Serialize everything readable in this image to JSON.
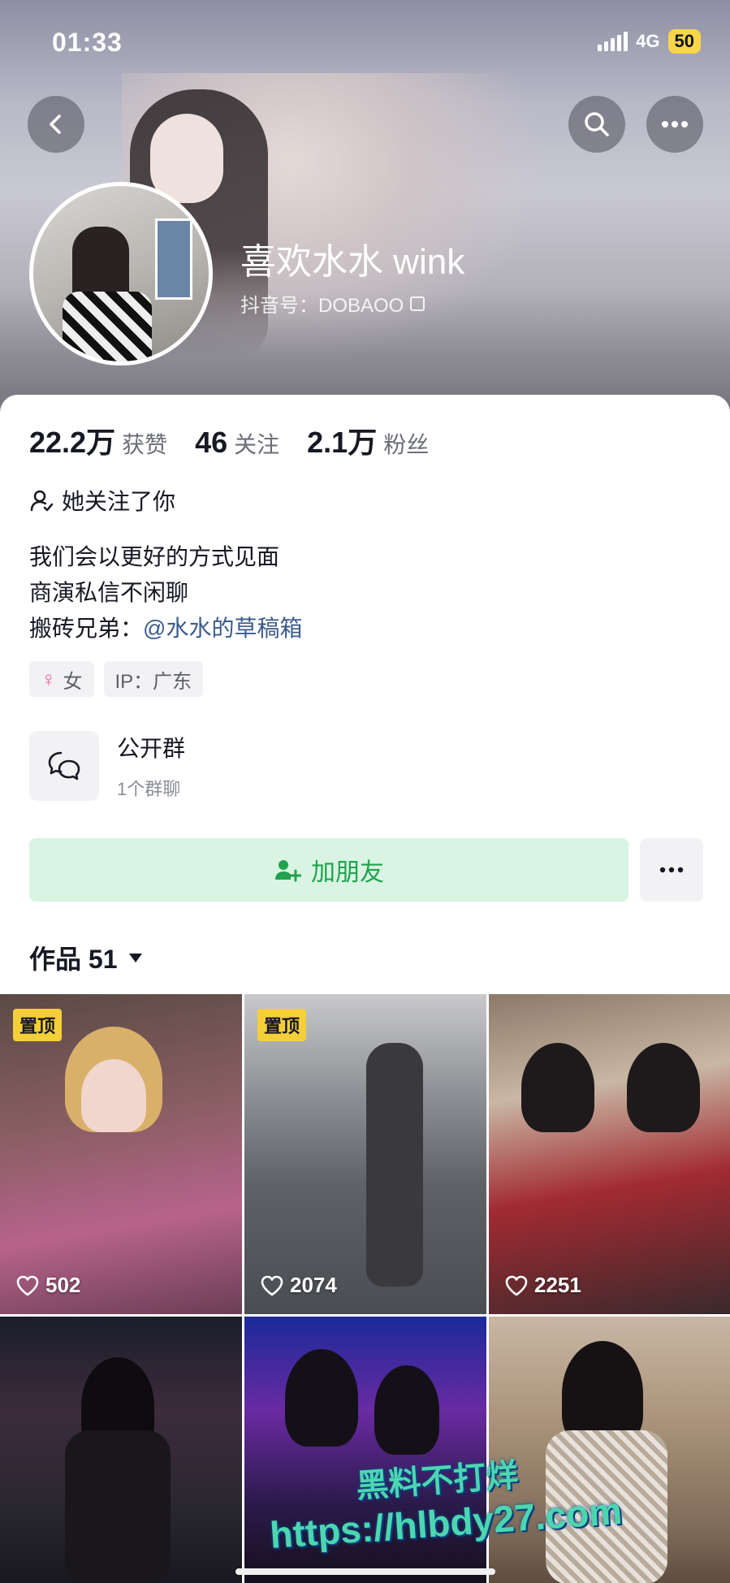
{
  "status_bar": {
    "time": "01:33",
    "network": "4G",
    "battery": "50"
  },
  "profile": {
    "nickname": "喜欢水水 wink",
    "douyin_id": "抖音号：DOBAOO"
  },
  "stats": [
    {
      "value": "22.2万",
      "label": "获赞"
    },
    {
      "value": "46",
      "label": "关注"
    },
    {
      "value": "2.1万",
      "label": "粉丝"
    }
  ],
  "follow_status": "她关注了你",
  "bio": {
    "line1": "我们会以更好的方式见面",
    "line2": "商演私信不闲聊",
    "line3_prefix": "搬砖兄弟：",
    "line3_mention": "@水水的草稿箱"
  },
  "tags": {
    "gender": "女",
    "ip": "IP：广东"
  },
  "group": {
    "title": "公开群",
    "subtitle": "1个群聊"
  },
  "actions": {
    "add_friend": "加朋友"
  },
  "works": {
    "label": "作品 51"
  },
  "grid": [
    {
      "pinned": "置顶",
      "likes": "502"
    },
    {
      "pinned": "置顶",
      "likes": "2074"
    },
    {
      "pinned": "",
      "likes": "2251"
    },
    {
      "pinned": "",
      "likes": ""
    },
    {
      "pinned": "",
      "likes": ""
    },
    {
      "pinned": "",
      "likes": ""
    }
  ],
  "watermark": {
    "line1": "黑料不打烊",
    "line2": "https://hlbdy27.com"
  },
  "icons": [
    "back-icon",
    "search-icon",
    "more-icon",
    "copy-icon",
    "person-icon",
    "chat-bubbles-icon",
    "add-person-icon",
    "heart-icon",
    "caret-down-icon"
  ],
  "colors": {
    "accent_green": "#20a24f",
    "add_friend_bg": "#d9f4e2",
    "pin_yellow": "#f5cf3a",
    "battery_yellow": "#f7d64a",
    "mention_blue": "#3b5b8c"
  }
}
